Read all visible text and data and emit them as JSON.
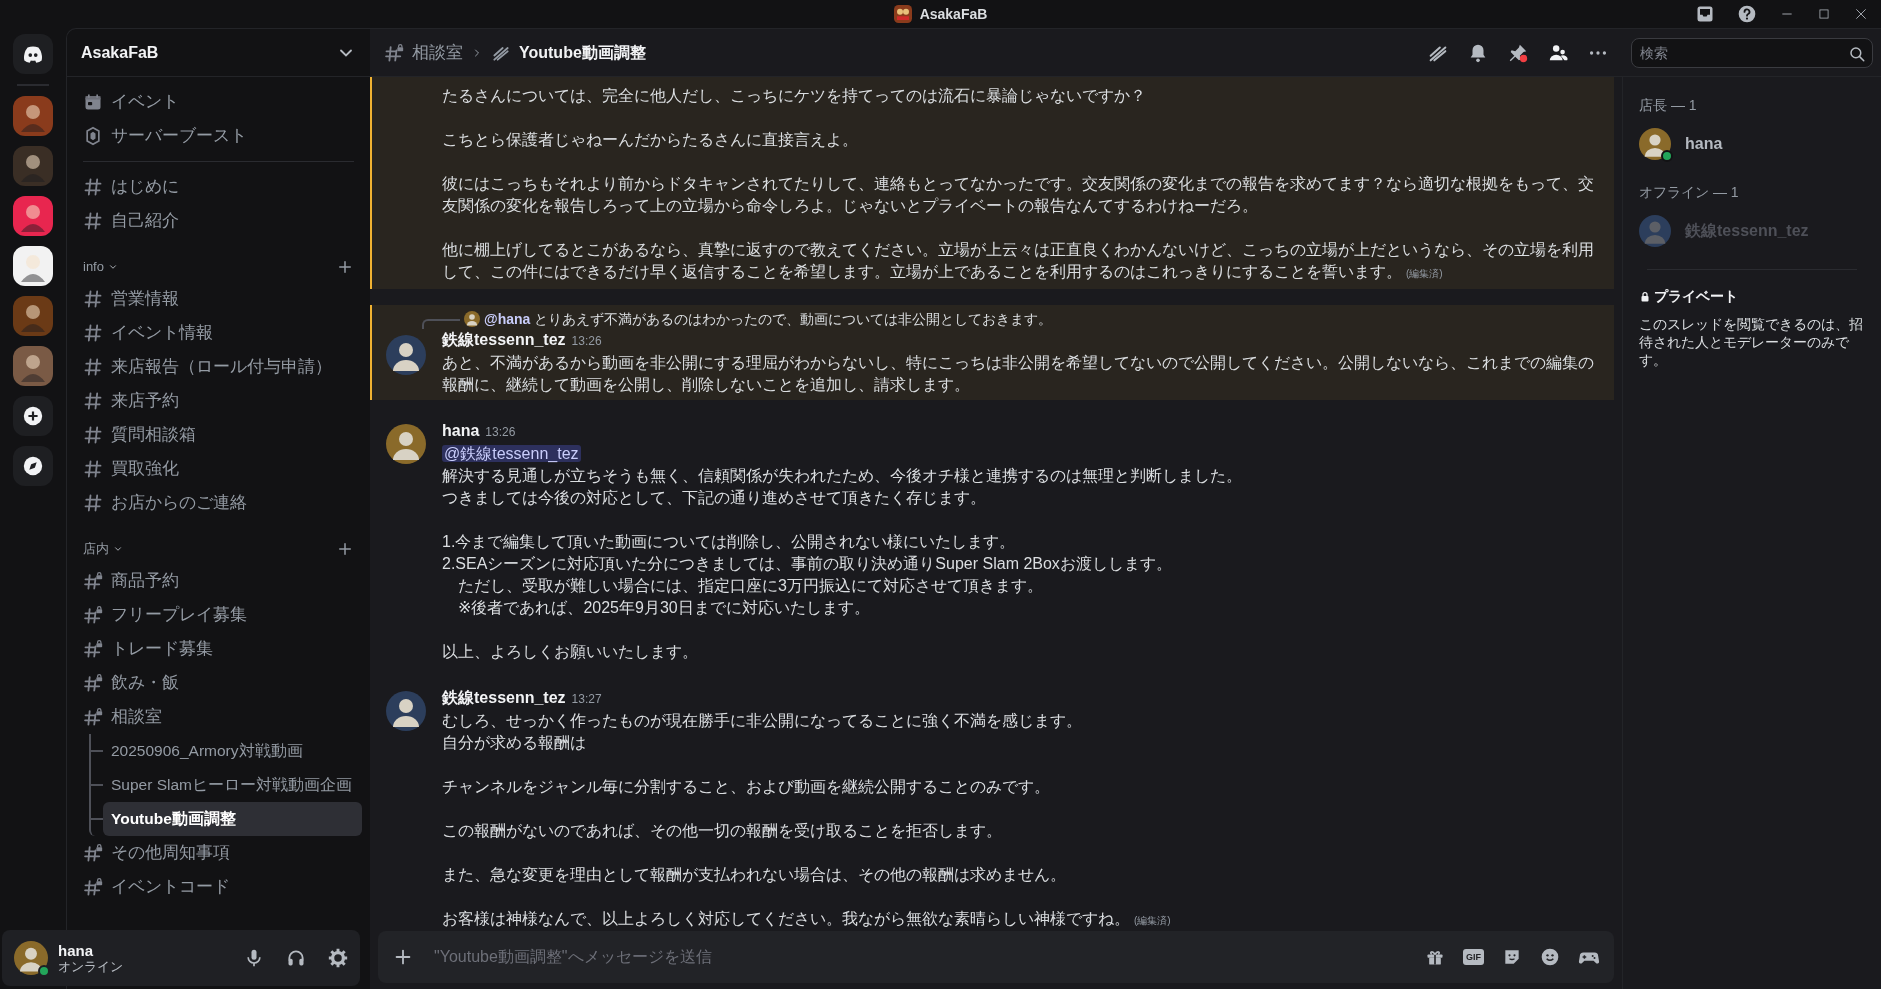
{
  "window": {
    "title": "AsakaFaB"
  },
  "servers": [
    {
      "kind": "home"
    },
    {
      "kind": "server",
      "color": "#8a3b1c"
    },
    {
      "kind": "server",
      "color": "#3a2e25"
    },
    {
      "kind": "server",
      "color": "#e8264f"
    },
    {
      "kind": "server",
      "color": "#f2f2f2"
    },
    {
      "kind": "server",
      "color": "#6b3a16"
    },
    {
      "kind": "server",
      "color": "#7a5a45"
    },
    {
      "kind": "add"
    },
    {
      "kind": "discover"
    }
  ],
  "server": {
    "name": "AsakaFaB"
  },
  "sidebar": {
    "top_items": [
      {
        "kind": "event",
        "label": "イベント"
      },
      {
        "kind": "boost",
        "label": "サーバーブースト"
      }
    ],
    "channels": [
      {
        "kind": "text",
        "label": "はじめに",
        "selected": false
      },
      {
        "kind": "text",
        "label": "自己紹介",
        "selected": false
      }
    ],
    "categories": [
      {
        "name": "info",
        "channels": [
          {
            "kind": "text",
            "label": "営業情報",
            "selected": false
          },
          {
            "kind": "text",
            "label": "イベント情報",
            "selected": false
          },
          {
            "kind": "text",
            "label": "来店報告（ロール付与申請）",
            "selected": false
          },
          {
            "kind": "text",
            "label": "来店予約",
            "selected": false
          },
          {
            "kind": "text",
            "label": "質問相談箱",
            "selected": false
          },
          {
            "kind": "text",
            "label": "買取強化",
            "selected": false
          },
          {
            "kind": "text",
            "label": "お店からのご連絡",
            "selected": false
          }
        ]
      },
      {
        "name": "店内",
        "channels": [
          {
            "kind": "locked",
            "label": "商品予約",
            "selected": false
          },
          {
            "kind": "locked",
            "label": "フリープレイ募集",
            "selected": false
          },
          {
            "kind": "locked",
            "label": "トレード募集",
            "selected": false
          },
          {
            "kind": "locked",
            "label": "飲み・飯",
            "selected": false
          },
          {
            "kind": "locked",
            "label": "相談室",
            "selected": false,
            "children": [
              {
                "kind": "thread",
                "label": "20250906_Armory対戦動画",
                "selected": false
              },
              {
                "kind": "thread",
                "label": "Super Slamヒーロー対戦動画企画",
                "selected": false
              },
              {
                "kind": "thread",
                "label": "Youtube動画調整",
                "selected": true
              }
            ]
          },
          {
            "kind": "locked",
            "label": "その他周知事項",
            "selected": false
          },
          {
            "kind": "locked",
            "label": "イベントコード",
            "selected": false
          }
        ]
      }
    ]
  },
  "user_panel": {
    "name": "hana",
    "status": "オンライン",
    "online": true,
    "color": "#8a6a2a"
  },
  "header": {
    "parent": "相談室",
    "thread": "Youtube動画調整",
    "pin_alert": true
  },
  "search": {
    "placeholder": "検索"
  },
  "messages": [
    {
      "highlighted": true,
      "paragraphs": [
        [
          "たるさんについては、完全に他人だし、こっちにケツを持てってのは流石に暴論じゃないですか？"
        ],
        [
          "こちとら保護者じゃねーんだからたるさんに直接言えよ。"
        ],
        [
          "彼にはこっちもそれより前からドタキャンされてたりして、連絡もとってなかったです。交友関係の変化までの報告を求めてます？なら適切な根拠をもって、交友関係の変化を報告しろって上の立場から命令しろよ。じゃないとプライベートの報告なんてするわけねーだろ。"
        ],
        [
          "他に棚上げしてるとこがあるなら、真摯に返すので教えてください。立場が上云々は正直良くわかんないけど、こっちの立場が上だというなら、その立場を利用して、この件にはできるだけ早く返信することを希望します。立場が上であることを利用するのはこれっきりにすることを誓います。"
        ]
      ],
      "edited": "(編集済)"
    },
    {
      "highlighted": true,
      "reply": {
        "author": "@hana",
        "text": "とりあえず不満があるのはわかったので、動画については非公開としておきます。",
        "color": "#8a6a2a"
      },
      "author": "鉄線tessenn_tez",
      "time": "13:26",
      "color": "#2c3e5c",
      "paragraphs": [
        [
          "あと、不満があるから動画を非公開にする理屈がわからないし、特にこっちは非公開を希望してないので公開してください。公開しないなら、これまでの編集の報酬に、継続して動画を公開し、削除しないことを追加し、請求します。"
        ]
      ]
    },
    {
      "highlighted": false,
      "author": "hana",
      "time": "13:26",
      "color": "#8a6a2a",
      "mention": "@鉄線tessenn_tez",
      "paragraphs": [
        [
          "解決する見通しが立ちそうも無く、信頼関係が失われたため、今後オチ様と連携するのは無理と判断しました。",
          "つきましては今後の対応として、下記の通り進めさせて頂きたく存じます。"
        ],
        [
          "1.今まで編集して頂いた動画については削除し、公開されない様にいたします。",
          "2.SEAシーズンに対応頂いた分につきましては、事前の取り決め通りSuper Slam 2Boxお渡しします。",
          "　ただし、受取が難しい場合には、指定口座に3万円振込にて対応させて頂きます。",
          "　※後者であれば、2025年9月30日までに対応いたします。"
        ],
        [
          "以上、よろしくお願いいたします。"
        ]
      ]
    },
    {
      "highlighted": false,
      "author": "鉄線tessenn_tez",
      "time": "13:27",
      "color": "#2c3e5c",
      "paragraphs": [
        [
          "むしろ、せっかく作ったものが現在勝手に非公開になってることに強く不満を感じます。",
          "自分が求める報酬は"
        ],
        [
          "チャンネルをジャンル毎に分割すること、および動画を継続公開することのみです。"
        ],
        [
          "この報酬がないのであれば、その他一切の報酬を受け取ることを拒否します。"
        ],
        [
          "また、急な変更を理由として報酬が支払われない場合は、その他の報酬は求めません。"
        ],
        [
          "お客様は神様なんで、以上よろしく対応してください。我ながら無欲な素晴らしい神様ですね。"
        ]
      ],
      "edited": "(編集済)"
    }
  ],
  "members": [
    {
      "title": "店長 — 1",
      "members": [
        {
          "name": "hana",
          "online": true,
          "color": "#8a6a2a"
        }
      ]
    },
    {
      "title": "オフライン — 1",
      "members": [
        {
          "name": "鉄線tessenn_tez",
          "online": false,
          "color": "#2c3e5c"
        }
      ]
    }
  ],
  "privacy": {
    "title": "プライベート",
    "text": "このスレッドを閲覧できるのは、招待された人とモデレーターのみです。"
  },
  "composer": {
    "placeholder": "\"Youtube動画調整\"へメッセージを送信",
    "gif_label": "GIF"
  }
}
